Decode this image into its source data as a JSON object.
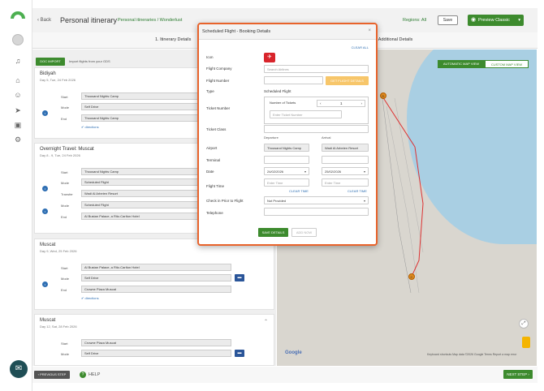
{
  "header": {
    "back_label": "Back",
    "title": "Personal itinerary",
    "breadcrumb": "Personal itineraries / Wonderlust",
    "regions_label": "Regions: All",
    "save_label": "Save",
    "preview_label": "Preview Classic"
  },
  "steps": {
    "step1": "1. Itinerary Details",
    "step2": "2. Additional Details"
  },
  "import": {
    "button_label": "DOC IMPORT",
    "text": "Import flights from your GDS"
  },
  "days": [
    {
      "title": "Bidiyah",
      "subtitle": "Day 5, Tue, 24 Feb 2026",
      "rows": [
        {
          "label": "Start",
          "value": "Thousand Nights Camp"
        },
        {
          "label": "Mode",
          "value": "Self Drive"
        },
        {
          "label": "End",
          "value": "Thousand Nights Camp"
        }
      ],
      "directions": "directions"
    },
    {
      "title": "Overnight Travel: Muscat",
      "subtitle": "Day 8 - 9, Tue, 24 Feb 2026",
      "rows": [
        {
          "label": "Start",
          "value": "Thousand Nights Camp"
        },
        {
          "label": "Mode",
          "value": "Scheduled Flight"
        },
        {
          "label": "Transfer",
          "value": "Wadi Al Arbeien Resort"
        },
        {
          "label": "Mode",
          "value": "Scheduled Flight"
        },
        {
          "label": "End",
          "value": "Al Bustan Palace, a Ritz-Carlton Hotel"
        }
      ]
    },
    {
      "title": "Muscat",
      "subtitle": "Day 9, Wed, 25 Feb 2026",
      "rows": [
        {
          "label": "Start",
          "value": "Al Bustan Palace, a Ritz-Carlton Hotel"
        },
        {
          "label": "Mode",
          "value": "Self Drive"
        },
        {
          "label": "End",
          "value": "Crowne Plaza Muscat"
        }
      ],
      "directions": "directions"
    },
    {
      "title": "Muscat",
      "subtitle": "Day 12, Sat, 28 Feb 2026",
      "rows": [
        {
          "label": "Start",
          "value": "Crowne Plaza Muscat"
        },
        {
          "label": "Mode",
          "value": "Self Drive"
        }
      ]
    }
  ],
  "footer": {
    "prev_label": "PREVIOUS STEP",
    "help_label": "HELP",
    "next_label": "NEXT STEP"
  },
  "map": {
    "toggle_auto": "AUTOMATIC MAP VIEW",
    "toggle_custom": "CUSTOM MAP VIEW",
    "marker_d": "D",
    "marker_c": "C",
    "google": "Google",
    "attribution": "Keyboard shortcuts   Map data ©2026 Google   Terms   Report a map error"
  },
  "modal": {
    "title": "Scheduled Flight - Booking Details",
    "close": "×",
    "clear_all": "CLEAR ALL",
    "icon_label": "Icon",
    "flight_company_label": "Flight Company",
    "flight_company_placeholder": "Search Airlines",
    "flight_number_label": "Flight Number",
    "get_flight_label": "GET FLIGHT DETAILS",
    "type_label": "Type",
    "type_value": "Scheduled Flight",
    "ticket_number_label": "Ticket Number",
    "number_of_tickets_label": "Number of Tickets",
    "tickets_count": "1",
    "ticket_placeholder": "Enter Ticket Number",
    "ticket_class_label": "Ticket Class",
    "departure_head": "Departure",
    "arrival_head": "Arrival",
    "airport_label": "Airport",
    "departure_airport": "Thousand Nights Camp",
    "arrival_airport": "Wadi Al Arbeien Resort",
    "terminal_label": "Terminal",
    "date_label": "Date",
    "departure_date": "24/02/2026",
    "arrival_date": "25/02/2026",
    "flight_time_label": "Flight Time",
    "time_placeholder": "Enter Time",
    "clear_time": "CLEAR TIME",
    "checkin_label": "Check in Prior to Flight",
    "checkin_value": "Not Provided",
    "telephone_label": "Telephone",
    "save_label": "SAVE DETAILS",
    "add_now_label": "ADD NOW"
  },
  "colors": {
    "accent_green": "#3d8b2e",
    "modal_border": "#e8632b",
    "link_blue": "#2f6fb3"
  }
}
